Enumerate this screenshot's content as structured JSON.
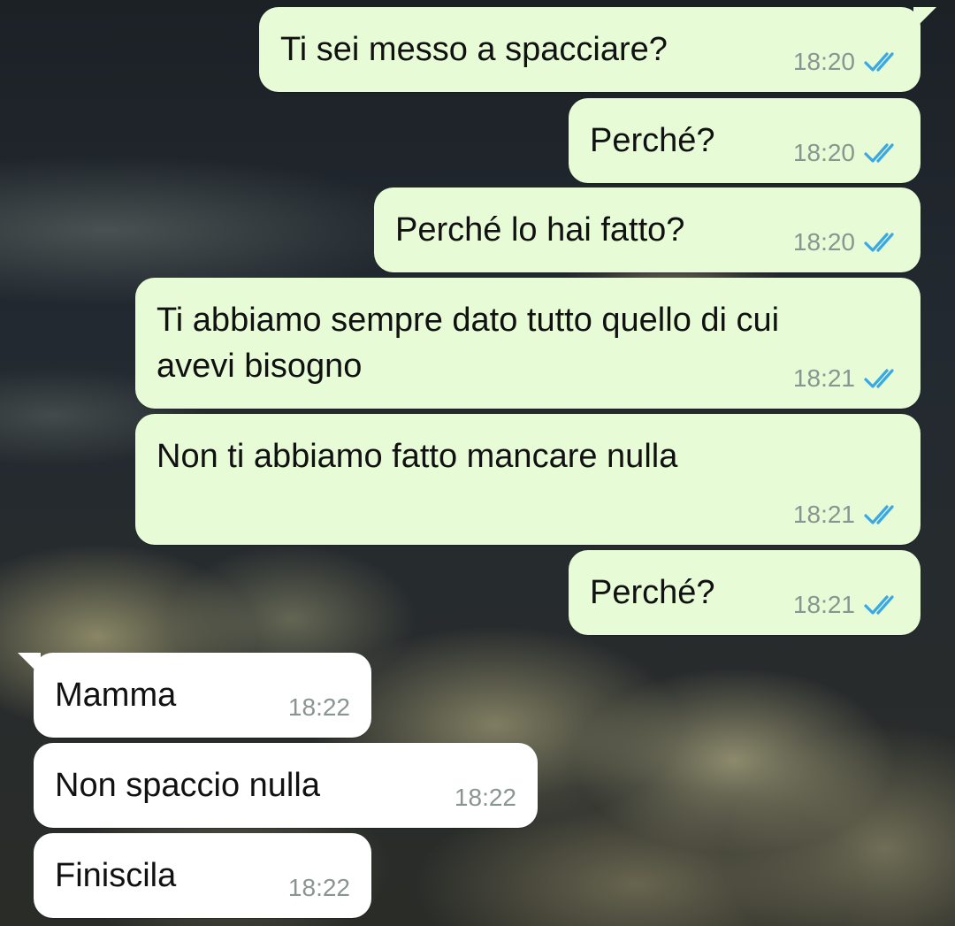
{
  "messages": [
    {
      "text": "Ti sei messo a spacciare?",
      "time": "18:20",
      "direction": "outgoing",
      "status": "read"
    },
    {
      "text": "Perché?",
      "time": "18:20",
      "direction": "outgoing",
      "status": "read"
    },
    {
      "text": "Perché lo hai fatto?",
      "time": "18:20",
      "direction": "outgoing",
      "status": "read"
    },
    {
      "text": "Ti abbiamo sempre dato tutto quello di cui\navevi bisogno",
      "time": "18:21",
      "direction": "outgoing",
      "status": "read"
    },
    {
      "text": "Non ti abbiamo fatto mancare nulla",
      "time": "18:21",
      "direction": "outgoing",
      "status": "read"
    },
    {
      "text": "Perché?",
      "time": "18:21",
      "direction": "outgoing",
      "status": "read"
    },
    {
      "text": "Mamma",
      "time": "18:22",
      "direction": "incoming"
    },
    {
      "text": "Non spaccio nulla",
      "time": "18:22",
      "direction": "incoming"
    },
    {
      "text": "Finiscila",
      "time": "18:22",
      "direction": "incoming"
    }
  ],
  "colors": {
    "outgoing_bubble": "#e7fcd6",
    "incoming_bubble": "#ffffff",
    "read_ticks": "#3ba7e3",
    "timestamp": "#8a9590"
  },
  "icons": {
    "read_receipt": "double-check-icon"
  }
}
